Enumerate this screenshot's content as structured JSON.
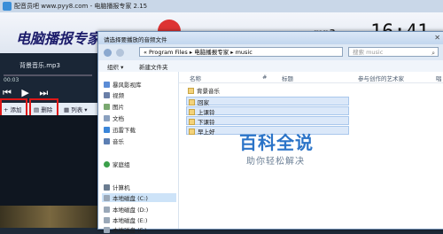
{
  "app": {
    "window_title": "配音员吧 www.pyy8.com - 电脑播报专家 2.15",
    "logo_text": "电脑播报专家",
    "format": "mp3",
    "clock": "16:41",
    "now_playing": "背景音乐.mp3",
    "elapsed": "00:03",
    "controls": "⏮ ▶ ⏭",
    "toolbar": {
      "add": "添加",
      "delete": "删除",
      "list": "列表"
    }
  },
  "dialog": {
    "title": "请选择要播放的音频文件",
    "close": "✕",
    "breadcrumb": "« Program Files ▸ 电脑播报专家 ▸ music",
    "search_placeholder": "搜索 music",
    "commands": {
      "organize": "组织 ▾",
      "new_folder": "新建文件夹"
    },
    "nav_items": [
      {
        "label": "暴风影视库",
        "color": "#5b8cd6"
      },
      {
        "label": "视频",
        "color": "#6a7fa8"
      },
      {
        "label": "图片",
        "color": "#7aa870"
      },
      {
        "label": "文档",
        "color": "#8aa0bf"
      },
      {
        "label": "迅雷下载",
        "color": "#3b86d9"
      },
      {
        "label": "音乐",
        "color": "#5c7fb3"
      },
      {
        "label": "家庭组",
        "color": "#3ba04a"
      },
      {
        "label": "计算机",
        "color": "#6b7c90"
      },
      {
        "label": "本地磁盘 (C:)",
        "color": "#9aa8b8"
      },
      {
        "label": "本地磁盘 (D:)",
        "color": "#9aa8b8"
      },
      {
        "label": "本地磁盘 (E:)",
        "color": "#9aa8b8"
      },
      {
        "label": "本地磁盘 (F:)",
        "color": "#9aa8b8"
      }
    ],
    "columns": {
      "name": "名称",
      "number": "#",
      "title": "标题",
      "artist": "参与创作的艺术家",
      "album": "唱"
    },
    "files": [
      "背景音乐",
      "回家",
      "上课铃",
      "下课铃",
      "早上好"
    ],
    "selected_files": [
      1,
      2,
      3,
      4
    ]
  },
  "watermark": {
    "brand": "百科全说",
    "slogan": "助你轻松解决"
  }
}
